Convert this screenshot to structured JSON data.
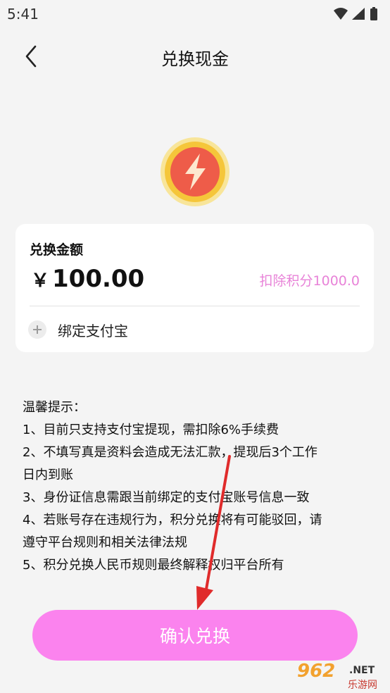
{
  "status_bar": {
    "time": "5:41",
    "icons": [
      "wifi-icon",
      "signal-icon",
      "battery-icon"
    ]
  },
  "header": {
    "title": "兑换现金",
    "back_icon": "chevron-left-icon"
  },
  "coin": {
    "icon": "lightning-coin-icon"
  },
  "card": {
    "label": "兑换金额",
    "currency": "￥",
    "amount": "100.00",
    "deduct": "扣除积分1000.0",
    "bind_label": "绑定支付宝",
    "bind_icon": "plus-circle-icon"
  },
  "tips": {
    "title": "温馨提示：",
    "lines": [
      "1、目前只支持支付宝提现，需扣除6%手续费",
      "2、不填写真是资料会造成无法汇款，提现后3个工作",
      "日内到账",
      "3、身份证信息需跟当前绑定的支付宝账号信息一致",
      "4、若账号存在违规行为，积分兑换将有可能驳回，请",
      "遵守平台规则和相关法律法规",
      "5、积分兑换人民币规则最终解释权归平台所有"
    ]
  },
  "confirm_label": "确认兑换",
  "watermark": {
    "text": "962",
    "suffix": ".NET",
    "sub": "乐游网"
  },
  "colors": {
    "accent_pink": "#fb83ee",
    "deduct_text": "#e883d8",
    "coin_ring": "#f7d84b",
    "coin_center": "#ef5f4c",
    "arrow": "#e02b2b"
  }
}
